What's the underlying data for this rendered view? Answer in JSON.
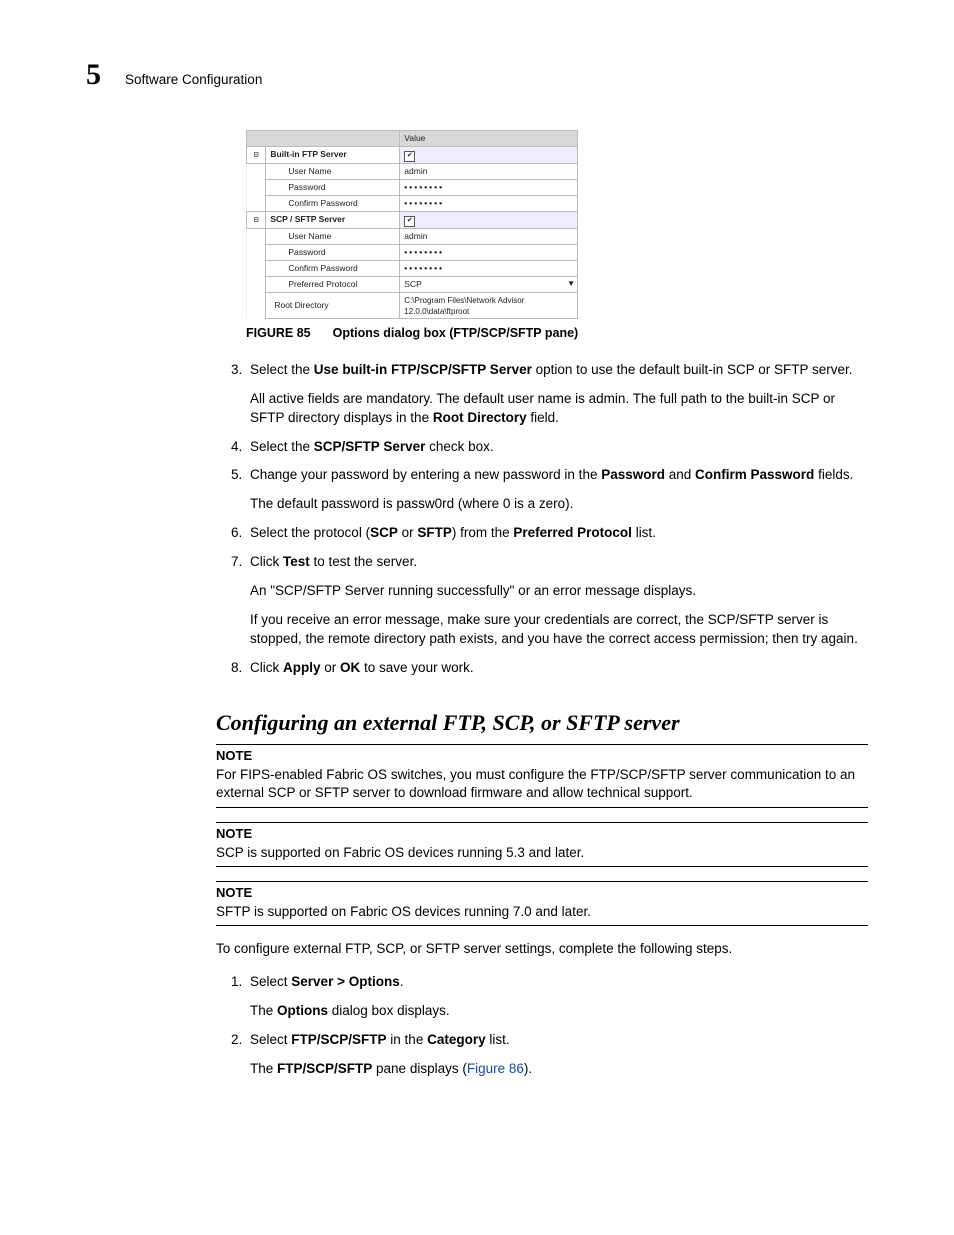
{
  "header": {
    "chapter_number": "5",
    "chapter_title": "Software Configuration"
  },
  "figure": {
    "header_val": "Value",
    "rows": {
      "g1": "Built-in FTP Server",
      "g1_user_k": "User Name",
      "g1_user_v": "admin",
      "g1_pw_k": "Password",
      "g1_pw_v": "••••••••",
      "g1_cpw_k": "Confirm Password",
      "g1_cpw_v": "••••••••",
      "g2": "SCP / SFTP Server",
      "g2_user_k": "User Name",
      "g2_user_v": "admin",
      "g2_pw_k": "Password",
      "g2_pw_v": "••••••••",
      "g2_cpw_k": "Confirm Password",
      "g2_cpw_v": "••••••••",
      "g2_proto_k": "Preferred Protocol",
      "g2_proto_v": "SCP",
      "root_k": "Root Directory",
      "root_v": "C:\\Program Files\\Network Advisor 12.0.0\\data\\ftproot"
    },
    "caption_label": "FIGURE 85",
    "caption_text": "Options dialog box (FTP/SCP/SFTP pane)"
  },
  "steps": {
    "s3a_pre": "Select the ",
    "s3a_b": "Use built-in FTP/SCP/SFTP Server",
    "s3a_post": " option to use the default built-in SCP or SFTP server.",
    "s3b_pre": "All active fields are mandatory. The default user name is admin. The full path to the built-in SCP or SFTP directory displays in the ",
    "s3b_b": "Root Directory",
    "s3b_post": " field.",
    "s4_pre": "Select the ",
    "s4_b": "SCP/SFTP Server",
    "s4_post": " check box.",
    "s5_pre": "Change your password by entering a new password in the ",
    "s5_b1": "Password",
    "s5_mid": " and ",
    "s5_b2": "Confirm Password",
    "s5_post": " fields.",
    "s5_extra": "The default password is passw0rd (where 0 is a zero).",
    "s6_pre": "Select the protocol (",
    "s6_b1": "SCP",
    "s6_mid1": " or ",
    "s6_b2": "SFTP",
    "s6_mid2": ") from the ",
    "s6_b3": "Preferred Protocol",
    "s6_post": " list.",
    "s7_pre": "Click ",
    "s7_b": "Test",
    "s7_post": " to test the server.",
    "s7_extra1": "An \"SCP/SFTP Server running successfully\" or an error message displays.",
    "s7_extra2": "If you receive an error message, make sure your credentials are correct, the SCP/SFTP server is stopped, the remote directory path exists, and you have the correct access permission; then try again.",
    "s8_pre": "Click ",
    "s8_b1": "Apply",
    "s8_mid": " or ",
    "s8_b2": "OK",
    "s8_post": " to save your work."
  },
  "subheading": "Configuring an external FTP, SCP, or SFTP server",
  "notes": {
    "label": "NOTE",
    "n1": "For FIPS-enabled Fabric OS switches, you must configure the FTP/SCP/SFTP server communication to an external SCP or SFTP server to download firmware and allow technical support.",
    "n2": "SCP is supported on Fabric OS devices running 5.3 and later.",
    "n3": "SFTP is supported on Fabric OS devices running 7.0 and later."
  },
  "para_intro": "To configure external FTP, SCP, or SFTP server settings, complete the following steps.",
  "steps2": {
    "s1_pre": "Select ",
    "s1_b": "Server > Options",
    "s1_post": ".",
    "s1_extra_pre": "The ",
    "s1_extra_b": "Options",
    "s1_extra_post": " dialog box displays.",
    "s2_pre": "Select ",
    "s2_b1": "FTP/SCP/SFTP",
    "s2_mid": " in the ",
    "s2_b2": "Category",
    "s2_post": " list.",
    "s2_extra_pre": "The ",
    "s2_extra_b": "FTP/SCP/SFTP",
    "s2_extra_mid": " pane displays (",
    "s2_extra_link": "Figure 86",
    "s2_extra_post": ")."
  }
}
